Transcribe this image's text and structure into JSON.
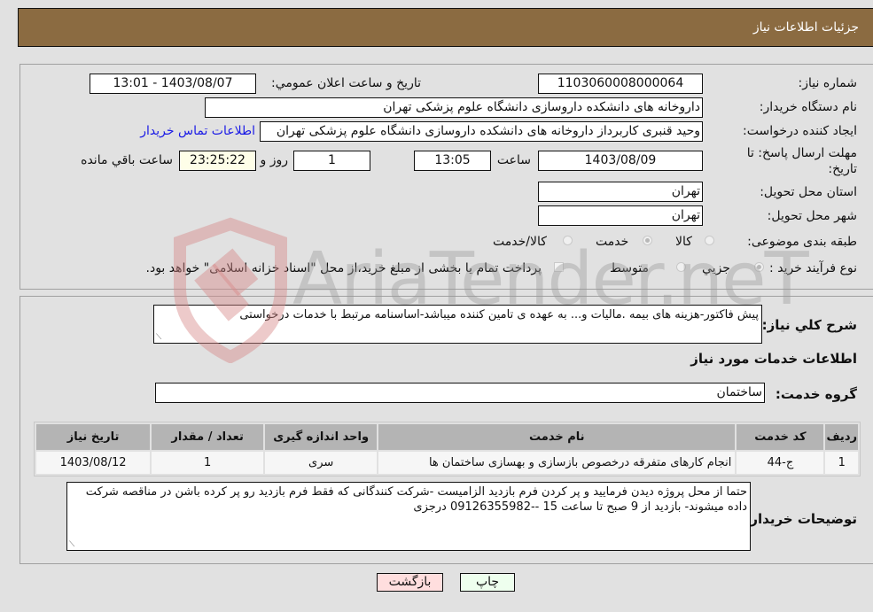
{
  "header": {
    "title": "جزئیات اطلاعات نیاز"
  },
  "details": {
    "need_number": {
      "label": "شماره نیاز:",
      "value": "1103060008000064"
    },
    "announce_datetime": {
      "label": "تاریخ و ساعت اعلان عمومي:",
      "value": "1403/08/07 - 13:01"
    },
    "buyer_org": {
      "label": "نام دستگاه خريدار:",
      "value": "داروخانه های دانشکده داروسازی دانشگاه علوم پزشکی تهران"
    },
    "requester": {
      "label": "ايجاد كننده درخواست:",
      "value": "وحید قنبری کاربرداز داروخانه های دانشکده داروسازی دانشگاه علوم پزشکی تهران",
      "contact_link": "اطلاعات تماس خريدار"
    },
    "deadline": {
      "label": "مهلت ارسال پاسخ: تا تاریخ:",
      "date": "1403/08/09",
      "time_label": "ساعت",
      "time": "13:05",
      "days": "1",
      "days_label": "روز و",
      "remaining": "23:25:22",
      "remaining_label": "ساعت باقي مانده"
    },
    "province": {
      "label": "استان محل تحويل:",
      "value": "تهران"
    },
    "city": {
      "label": "شهر محل تحويل:",
      "value": "تهران"
    },
    "category": {
      "label": "طبقه بندی موضوعی:",
      "options": [
        "كالا",
        "خدمت",
        "كالا/خدمت"
      ],
      "selected": "خدمت"
    },
    "purchase_type": {
      "label": "نوع فرآيند خريد :",
      "options": [
        "جزيي",
        "متوسط"
      ],
      "selected": "جزيي",
      "treasury_checkbox_label": "پرداخت تمام يا بخشی از مبلغ خريد،از محل \"اسناد خزانه اسلامی\" خواهد بود.",
      "treasury_checked": false
    }
  },
  "services": {
    "description_label": "شرح كلي نياز:",
    "description": "پیش فاکتور-هزینه های بیمه .مالیات و... به عهده ی تامین کننده میباشد-اساسنامه مرتبط با خدمات درخواستی",
    "section_title": "اطلاعات خدمات مورد نياز",
    "group_label": "گروه خدمت:",
    "group_value": "ساختمان",
    "table": {
      "headers": [
        "رديف",
        "كد خدمت",
        "نام خدمت",
        "واحد اندازه گيری",
        "تعداد / مقدار",
        "تاريخ نياز"
      ],
      "rows": [
        [
          "1",
          "ج-44",
          "انجام کارهای متفرقه درخصوص بازسازی و بهسازی ساختمان ها",
          "سری",
          "1",
          "1403/08/12"
        ]
      ]
    },
    "buyer_notes_label": "توضيحات خريدار:",
    "buyer_notes": "حتما از محل پروژه دیدن فرمایید و پر کردن  فرم بازدید الزامیست -شرکت کنندگانی که فقط فرم بازدید رو پر کرده باشن در مناقصه شرکت داده میشوند- بازدید از 9 صبح تا ساعت 15 --09126355982 درجزی"
  },
  "actions": {
    "print": "چاپ",
    "back": "بازگشت"
  },
  "colors": {
    "header": "#8b6b41",
    "print_bg": "#eeffee",
    "back_bg": "#ffdede",
    "link": "#1a1ae6"
  },
  "watermark": "AriaTender.neT"
}
